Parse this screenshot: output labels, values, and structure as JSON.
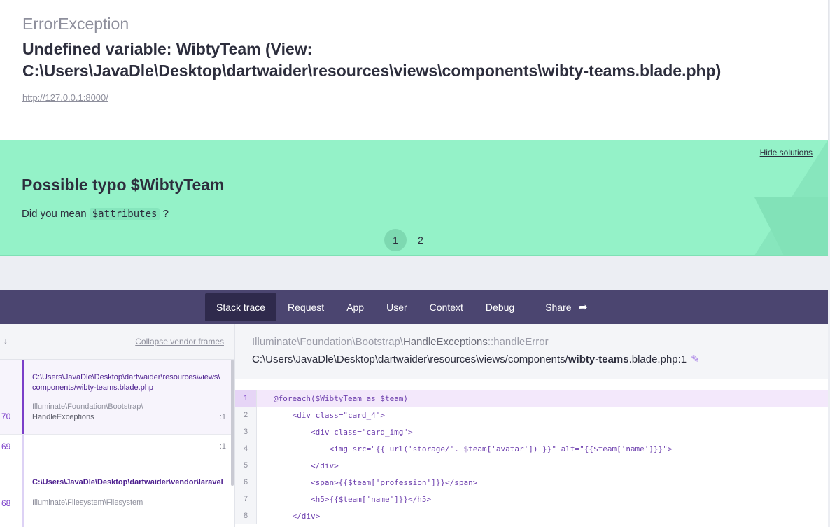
{
  "header": {
    "exception_class": "ErrorException",
    "message": "Undefined variable: WibtyTeam (View: C:\\Users\\JavaDle\\Desktop\\dartwaider\\resources\\views\\components\\wibty-teams.blade.php)",
    "url": "http://127.0.0.1:8000/"
  },
  "solutions": {
    "hide_label": "Hide solutions",
    "title": "Possible typo $WibtyTeam",
    "desc_prefix": "Did you mean",
    "desc_code": "$attributes",
    "desc_suffix": "?",
    "pages": [
      "1",
      "2"
    ]
  },
  "nav": {
    "tabs": [
      "Stack trace",
      "Request",
      "App",
      "User",
      "Context",
      "Debug"
    ],
    "share_label": "Share"
  },
  "frames": {
    "collapse_label": "Collapse vendor frames",
    "arrow": "↓",
    "items": [
      {
        "num": "70",
        "path": "C:\\Users\\JavaDle\\Desktop\\dartwaider\\resources\\views\\",
        "path2": "components/wibty-teams.blade.php",
        "cls": "Illuminate\\Foundation\\Bootstrap\\",
        "cls2": "HandleExceptions",
        "line": ":1"
      },
      {
        "num": "69",
        "line": ":1"
      },
      {
        "num": "68",
        "path": "C:\\Users\\JavaDle\\Desktop\\dartwaider\\vendor\\laravel",
        "cls": "Illuminate\\Filesystem\\Filesystem"
      }
    ]
  },
  "code": {
    "class_prefix": "Illuminate\\Foundation\\Bootstrap\\",
    "class_name": "HandleExceptions",
    "method": "::handleError",
    "file_prefix": "C:\\Users\\JavaDle\\Desktop\\dartwaider\\resources\\views/components/",
    "file_name": "wibty-teams",
    "file_suffix": ".blade.php:1",
    "lines": [
      {
        "no": "1",
        "text": "@foreach($WibtyTeam as $team)"
      },
      {
        "no": "2",
        "text": "    <div class=\"card_4\">"
      },
      {
        "no": "3",
        "text": "        <div class=\"card_img\">"
      },
      {
        "no": "4",
        "text": "            <img src=\"{{ url('storage/'. $team['avatar']) }}\" alt=\"{{$team['name']}}\">"
      },
      {
        "no": "5",
        "text": "        </div>"
      },
      {
        "no": "6",
        "text": "        <span>{{$team['profession']}}</span>"
      },
      {
        "no": "7",
        "text": "        <h5>{{$team['name']}}</h5>"
      },
      {
        "no": "8",
        "text": "    </div>"
      }
    ]
  }
}
